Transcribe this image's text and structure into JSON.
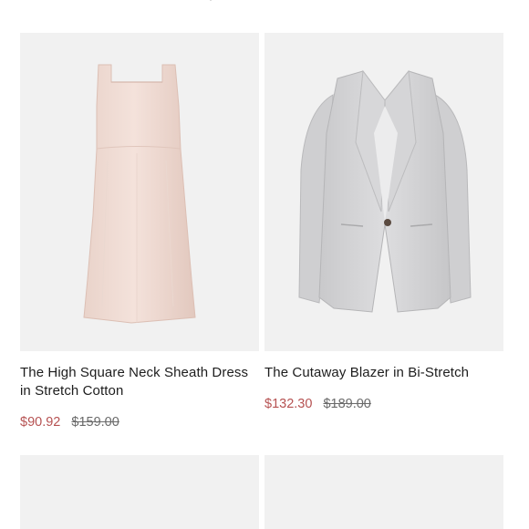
{
  "products": [
    {
      "name": "The High Square Neck Sheath Dress in Stretch Cotton",
      "sale_price": "$90.92",
      "original_price": "$159.00",
      "image_icon": "dress-image"
    },
    {
      "name": "The Cutaway Blazer in Bi-Stretch",
      "sale_price": "$132.30",
      "original_price": "$189.00",
      "image_icon": "blazer-image"
    }
  ],
  "colors": {
    "sale": "#b65252",
    "image_background": "#f1f1f1",
    "text": "#1d1d1d",
    "strike": "#6a6a6a"
  }
}
